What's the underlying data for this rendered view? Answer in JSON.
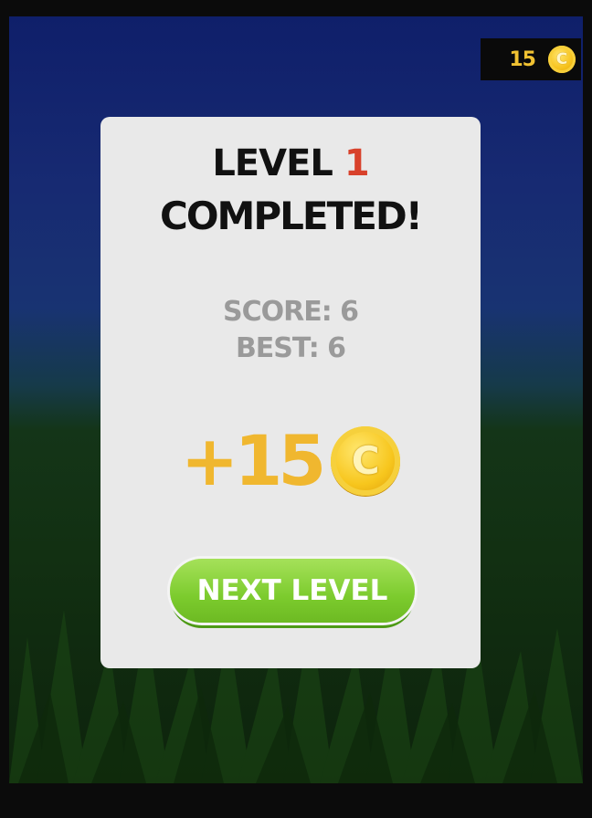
{
  "hud": {
    "coin_count": "15",
    "coin_glyph": "C"
  },
  "panel": {
    "title_word": "LEVEL",
    "level_number": "1",
    "title_line2": "COMPLETED!",
    "score_label": "SCORE: 6",
    "best_label": "BEST: 6",
    "reward_amount": "+15",
    "reward_coin_glyph": "C",
    "next_button_label": "NEXT LEVEL"
  },
  "icons": {
    "hud_coin": "coin-icon",
    "reward_coin": "coin-icon"
  },
  "colors": {
    "level_number": "#d8412b",
    "reward": "#f0b72f",
    "button": "#7ccb2d",
    "panel": "#e9e9e9",
    "muted_text": "#9a9a9a"
  }
}
